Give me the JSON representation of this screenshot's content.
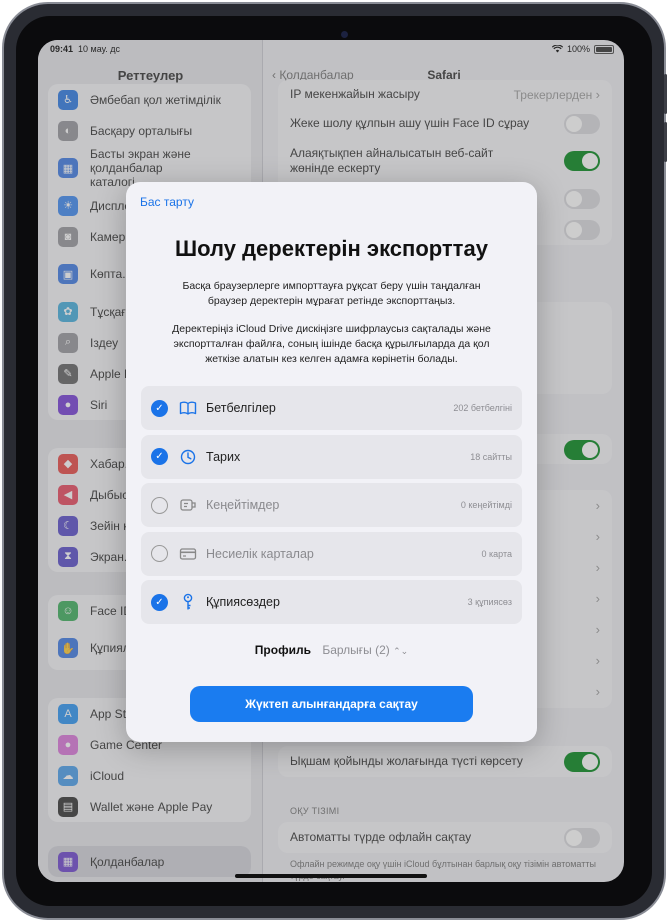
{
  "status": {
    "time": "09:41",
    "date": "10 мау. дс",
    "battery": "100%"
  },
  "sidebar": {
    "title": "Реттеулер",
    "groups": [
      [
        {
          "label": "Әмбебап қол жетімділік",
          "icon": "accessibility-icon",
          "color": "#1c6fe0"
        },
        {
          "label": "Басқару орталығы",
          "icon": "control-center-icon",
          "color": "#8e8e93"
        },
        {
          "label": "Басты экран және қолданбалар каталогі",
          "icon": "home-screen-icon",
          "color": "#2f6fe0"
        },
        {
          "label": "Диспле...",
          "icon": "brightness-icon",
          "color": "#2f7fef"
        },
        {
          "label": "Камер...",
          "icon": "camera-icon",
          "color": "#8e8e93"
        },
        {
          "label": "Көпта... пен қи...",
          "icon": "multitasking-icon",
          "color": "#2f6fe0"
        },
        {
          "label": "Тұсқағ...",
          "icon": "wallpaper-icon",
          "color": "#35a7d8"
        },
        {
          "label": "Іздеу",
          "icon": "search-icon",
          "color": "#8e8e93"
        },
        {
          "label": "Apple P...",
          "icon": "pencil-icon",
          "color": "#555555"
        },
        {
          "label": "Siri",
          "icon": "siri-icon",
          "color": "#6a2fd0"
        }
      ],
      [
        {
          "label": "Хабар...",
          "icon": "notifications-icon",
          "color": "#e53935"
        },
        {
          "label": "Дыбыс...",
          "icon": "sound-icon",
          "color": "#e53950"
        },
        {
          "label": "Зейін қ...",
          "icon": "focus-icon",
          "color": "#4b3fc4"
        },
        {
          "label": "Экран...",
          "icon": "screen-time-icon",
          "color": "#4b3fc4"
        }
      ],
      [
        {
          "label": "Face ID...",
          "icon": "face-id-icon",
          "color": "#2fa84f"
        },
        {
          "label": "Құпиял... қауіпс...",
          "icon": "privacy-hand-icon",
          "color": "#2f6fe0"
        }
      ],
      [
        {
          "label": "App St...",
          "icon": "app-store-icon",
          "color": "#1c8cf0"
        },
        {
          "label": "Game Center",
          "icon": "game-center-icon",
          "color": "#d66ad6"
        },
        {
          "label": "iCloud",
          "icon": "icloud-icon",
          "color": "#3b95e8"
        },
        {
          "label": "Wallet және Apple Pay",
          "icon": "wallet-icon",
          "color": "#222222"
        }
      ],
      [
        {
          "label": "Қолданбалар",
          "icon": "apps-grid-icon",
          "color": "#6a3fd0"
        }
      ]
    ]
  },
  "detail": {
    "back": "Қолданбалар",
    "title": "Safari",
    "rows_top": [
      {
        "label": "IP мекенжайын жасыру",
        "value": "Трекерлерден",
        "type": "chevron"
      },
      {
        "label": "Жеке шолу құлпын ашу үшін Face ID сұрау",
        "type": "toggle",
        "on": false
      },
      {
        "label": "Алаяқтықпен айналысатын веб-сайт жөнінде ескерту",
        "type": "toggle",
        "on": true
      }
    ],
    "row_compact": {
      "label": "Ықшам қойынды жолағында түсті көрсету",
      "on": true
    },
    "section_reading": "ОҚУ ТІЗІМІ",
    "row_offline": {
      "label": "Автоматты түрде офлайн сақтау",
      "on": false
    },
    "footer_text": "Офлайн режимде оқу үшін iCloud бұлтынан барлық оқу тізімін автоматты түрде сақтау."
  },
  "sheet": {
    "cancel": "Бас тарту",
    "title": "Шолу деректерін экспорттау",
    "desc1": "Басқа браузерлерге импорттауға рұқсат беру үшін таңдалған браузер деректерін мұрағат ретінде экспорттаңыз.",
    "desc2": "Деректеріңіз iCloud Drive дискіңізге шифрлаусыз сақталады және экспортталған файлға, соның ішінде басқа құрылғыларда да қол жеткізе алатын кез келген адамға көрінетін болады.",
    "items": [
      {
        "label": "Бетбелгілер",
        "count": "202 бетбелгіні",
        "checked": true,
        "icon": "book-icon"
      },
      {
        "label": "Тарих",
        "count": "18 сайтты",
        "checked": true,
        "icon": "clock-icon"
      },
      {
        "label": "Кеңейтімдер",
        "count": "0 кеңейтімді",
        "checked": false,
        "icon": "extension-icon"
      },
      {
        "label": "Несиелік карталар",
        "count": "0 карта",
        "checked": false,
        "icon": "credit-card-icon"
      },
      {
        "label": "Құпиясөздер",
        "count": "3 құпиясөз",
        "checked": true,
        "icon": "key-icon"
      }
    ],
    "profile_label": "Профиль",
    "profile_value": "Барлығы (2)",
    "save_button": "Жүктеп алынғандарға сақтау"
  },
  "colors": {
    "accent": "#1a73e8",
    "toggle_on": "#2f9a43"
  }
}
